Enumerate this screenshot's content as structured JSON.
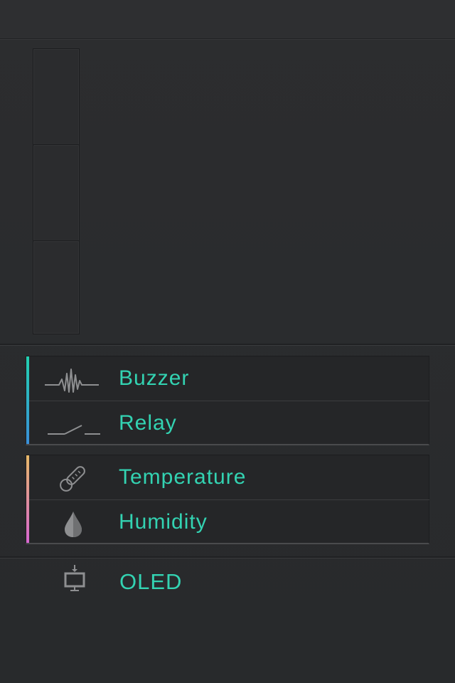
{
  "theme": {
    "accent_text": "#33d3b2",
    "outputs_accent": [
      "#23d0b0",
      "#3a8fd8"
    ],
    "sensors_accent": [
      "#e6b968",
      "#d767d0"
    ]
  },
  "outputs": {
    "items": [
      {
        "label": "Buzzer",
        "icon": "buzzer-waveform-icon"
      },
      {
        "label": "Relay",
        "icon": "relay-switch-icon"
      }
    ]
  },
  "sensors": {
    "items": [
      {
        "label": "Temperature",
        "icon": "thermometer-icon"
      },
      {
        "label": "Humidity",
        "icon": "water-drop-icon"
      }
    ]
  },
  "display": {
    "label": "OLED",
    "icon": "oled-display-icon"
  }
}
